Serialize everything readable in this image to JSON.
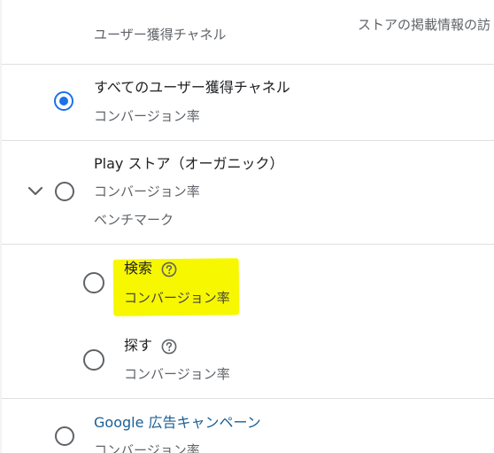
{
  "header": {
    "column_label": "ユーザー獲得チャネル",
    "right_column_label": "ストアの掲載情報の訪"
  },
  "rows": [
    {
      "title": "すべてのユーザー獲得チャネル",
      "subtitle": "コンバージョン率",
      "selected": true
    },
    {
      "title": "Play ストア（オーガニック）",
      "subtitle": "コンバージョン率",
      "extra": "ベンチマーク",
      "selected": false,
      "expanded": true,
      "children": [
        {
          "title": "検索",
          "subtitle": "コンバージョン率",
          "selected": false,
          "highlighted": true
        },
        {
          "title": "探す",
          "subtitle": "コンバージョン率",
          "selected": false
        }
      ]
    },
    {
      "title": "Google 広告キャンペーン",
      "subtitle": "コンバージョン率",
      "selected": false
    }
  ],
  "icons": {
    "expand": "chevron-down-icon",
    "help": "help-circle-icon"
  },
  "colors": {
    "accent": "#1a73e8",
    "link": "#1a5f96",
    "highlight": "#f7f700",
    "divider": "#e0e0e0"
  }
}
